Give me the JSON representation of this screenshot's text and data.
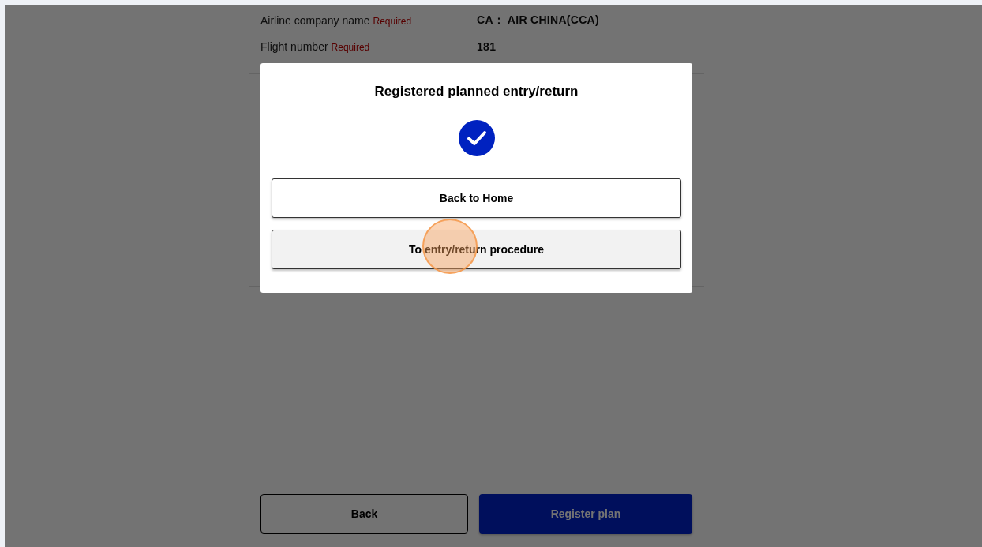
{
  "form": {
    "fields": [
      {
        "label": "Airline company name",
        "required_tag": "Required",
        "value": "CA： AIR CHINA(CCA)"
      },
      {
        "label": "Flight number",
        "required_tag": "Required",
        "value": "181"
      }
    ]
  },
  "footer_buttons": [
    {
      "label": "Back",
      "kind": "secondary"
    },
    {
      "label": "Register plan",
      "kind": "primary"
    }
  ],
  "dialog": {
    "title": "Registered planned entry/return",
    "buttons": [
      {
        "label": "Back to Home",
        "hovered": false
      },
      {
        "label": "To entry/return procedure",
        "hovered": true
      }
    ]
  }
}
